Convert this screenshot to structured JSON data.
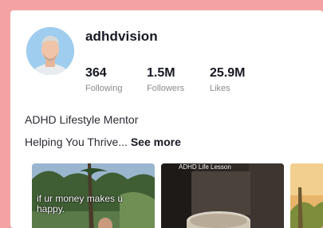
{
  "profile": {
    "username": "adhdvision",
    "stats": [
      {
        "value": "364",
        "label": "Following"
      },
      {
        "value": "1.5M",
        "label": "Followers"
      },
      {
        "value": "25.9M",
        "label": "Likes"
      }
    ],
    "bio_line1": "ADHD Lifestyle Mentor",
    "bio_line2": "Helping You Thrive...",
    "see_more": "See more"
  },
  "videos": [
    {
      "caption": "if ur money makes u happy."
    },
    {
      "caption": "ADHD Life Lesson"
    },
    {
      "caption": ""
    }
  ],
  "colors": {
    "background": "#f4a3a3",
    "card": "#ffffff",
    "text_primary": "#161823",
    "text_secondary": "#8a8b91"
  }
}
